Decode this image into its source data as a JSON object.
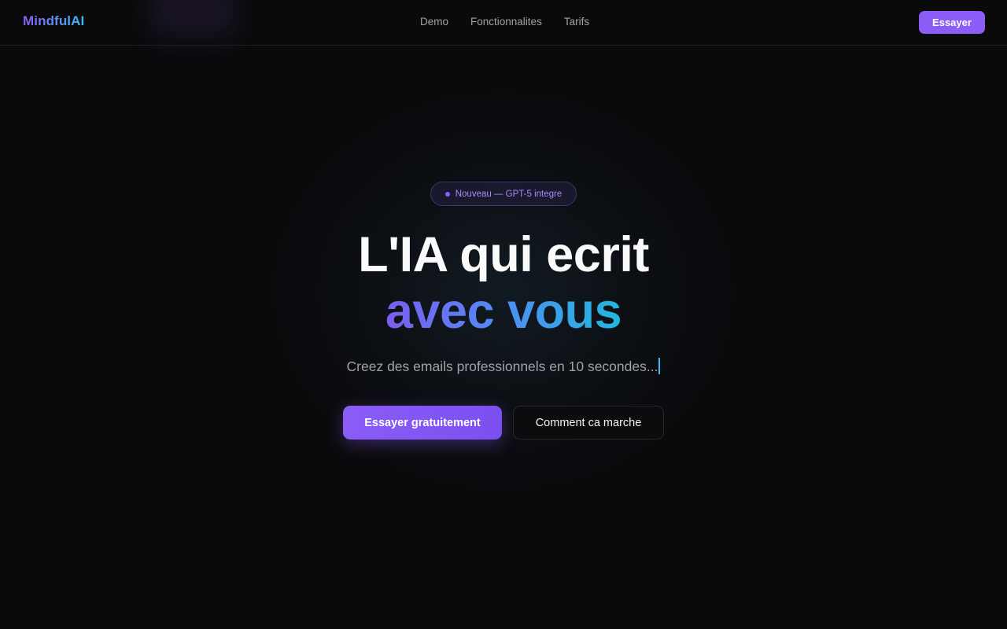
{
  "brand": {
    "name": "MindfulAI",
    "gradient_start": "#8b5cf6",
    "gradient_end": "#38bdf8"
  },
  "nav": {
    "links": [
      {
        "label": "Demo"
      },
      {
        "label": "Fonctionnalites"
      },
      {
        "label": "Tarifs"
      }
    ],
    "cta_label": "Essayer"
  },
  "hero": {
    "badge_text": "Nouveau — GPT-5 integre",
    "headline_line1": "L'IA qui ecrit",
    "headline_line2": "avec vous",
    "subtitle": "Creez des emails professionnels en 10 secondes...",
    "primary_cta": "Essayer gratuitement",
    "secondary_cta": "Comment ca marche"
  },
  "colors": {
    "accent": "#8b5cf6",
    "background": "#0a0a0c",
    "caret": "#38bdf8"
  },
  "icons": {
    "badge_dot": "dot-icon",
    "caret": "text-caret"
  }
}
